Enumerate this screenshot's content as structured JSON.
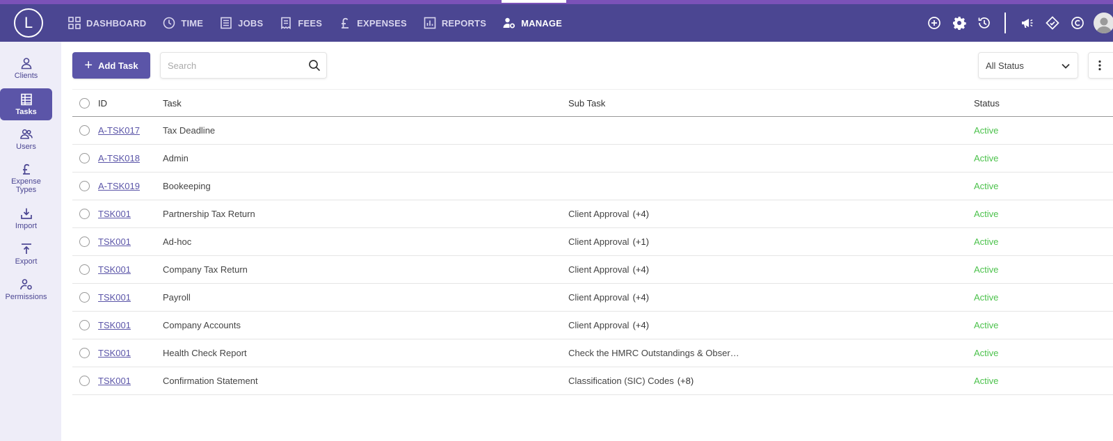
{
  "app": {
    "logo_letter": "L"
  },
  "nav": {
    "items": [
      {
        "label": "DASHBOARD",
        "icon": "grid-icon"
      },
      {
        "label": "TIME",
        "icon": "clock-icon"
      },
      {
        "label": "JOBS",
        "icon": "list-icon"
      },
      {
        "label": "FEES",
        "icon": "receipt-icon"
      },
      {
        "label": "EXPENSES",
        "icon": "pound-icon"
      },
      {
        "label": "REPORTS",
        "icon": "bar-chart-icon"
      },
      {
        "label": "MANAGE",
        "icon": "user-gear-icon",
        "active": true
      }
    ]
  },
  "topbar_icons": [
    "add-circle-icon",
    "gear-icon",
    "history-icon",
    "megaphone-icon",
    "diamond-icon",
    "copyright-icon",
    "avatar"
  ],
  "sidebar": {
    "items": [
      {
        "label": "Clients",
        "icon": "person-icon"
      },
      {
        "label": "Tasks",
        "icon": "table-icon",
        "active": true
      },
      {
        "label": "Users",
        "icon": "users-icon"
      },
      {
        "label": "Expense Types",
        "icon": "pound-icon"
      },
      {
        "label": "Import",
        "icon": "import-icon"
      },
      {
        "label": "Export",
        "icon": "export-icon"
      },
      {
        "label": "Permissions",
        "icon": "user-gear-icon"
      }
    ]
  },
  "toolbar": {
    "add_label": "Add Task",
    "search_placeholder": "Search",
    "status_value": "All Status"
  },
  "table": {
    "columns": [
      "ID",
      "Task",
      "Sub Task",
      "Status"
    ],
    "rows": [
      {
        "id": "A-TSK017",
        "task": "Tax Deadline",
        "sub": "",
        "count": "",
        "status": "Active"
      },
      {
        "id": "A-TSK018",
        "task": "Admin",
        "sub": "",
        "count": "",
        "status": "Active"
      },
      {
        "id": "A-TSK019",
        "task": "Bookeeping",
        "sub": "",
        "count": "",
        "status": "Active"
      },
      {
        "id": "TSK001",
        "task": "Partnership Tax Return",
        "sub": "Client Approval",
        "count": "(+4)",
        "status": "Active"
      },
      {
        "id": "TSK001",
        "task": "Ad-hoc",
        "sub": "Client Approval",
        "count": "(+1)",
        "status": "Active"
      },
      {
        "id": "TSK001",
        "task": "Company Tax Return",
        "sub": "Client Approval",
        "count": "(+4)",
        "status": "Active"
      },
      {
        "id": "TSK001",
        "task": "Payroll",
        "sub": "Client Approval",
        "count": "(+4)",
        "status": "Active"
      },
      {
        "id": "TSK001",
        "task": "Company Accounts",
        "sub": "Client Approval",
        "count": "(+4)",
        "status": "Active"
      },
      {
        "id": "TSK001",
        "task": "Health Check Report",
        "sub": "Check the HMRC Outstandings & Obser…",
        "count": "",
        "status": "Active"
      },
      {
        "id": "TSK001",
        "task": "Confirmation Statement",
        "sub": "Classification (SIC) Codes",
        "count": "(+8)",
        "status": "Active"
      }
    ]
  },
  "colors": {
    "nav_bg": "#4b4692",
    "accent": "#5b55a8",
    "sidebar_bg": "#eeedf8",
    "status_active": "#4cc24c"
  }
}
